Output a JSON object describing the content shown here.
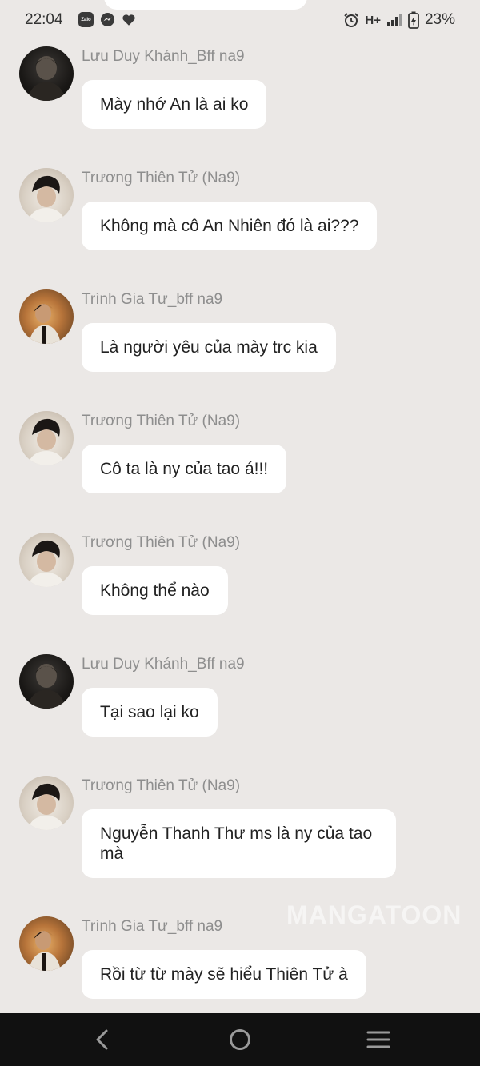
{
  "status_bar": {
    "time": "22:04",
    "zalo_label": "Zalo",
    "network": "H+",
    "battery_pct": "23%"
  },
  "messages": [
    {
      "sender": "Lưu Duy Khánh_Bff na9",
      "text": "Mày nhớ An là ai ko",
      "avatar": "dark"
    },
    {
      "sender": "Trương Thiên Tử (Na9)",
      "text": "Không mà cô An Nhiên đó là ai???",
      "avatar": "light"
    },
    {
      "sender": "Trình Gia Tư_bff na9",
      "text": "Là người yêu của mày trc kia",
      "avatar": "warm"
    },
    {
      "sender": "Trương Thiên Tử (Na9)",
      "text": "Cô ta là ny của tao á!!!",
      "avatar": "light"
    },
    {
      "sender": "Trương Thiên Tử (Na9)",
      "text": "Không thể nào",
      "avatar": "light"
    },
    {
      "sender": "Lưu Duy Khánh_Bff na9",
      "text": "Tại sao lại ko",
      "avatar": "dark"
    },
    {
      "sender": "Trương Thiên Tử (Na9)",
      "text": "Nguyễn Thanh Thư ms là ny của tao mà",
      "avatar": "light"
    },
    {
      "sender": "Trình Gia Tư_bff na9",
      "text": "Rồi từ từ mày sẽ hiểu Thiên Tử à",
      "avatar": "warm"
    }
  ],
  "watermark": "MANGATOON",
  "colors": {
    "background": "#ebe8e6",
    "bubble": "#ffffff",
    "sender_text": "#8e8e8e",
    "nav_bar": "#111111"
  }
}
